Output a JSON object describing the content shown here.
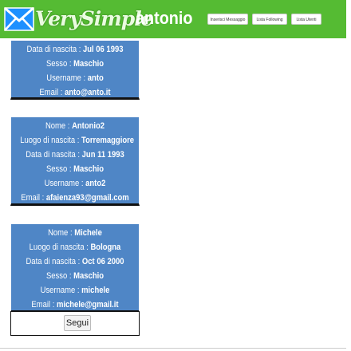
{
  "header": {
    "logo_text": "VerySimple",
    "username": "antonio",
    "nav": [
      {
        "label": "Inserisci Messaggio"
      },
      {
        "label": "Lista Following"
      },
      {
        "label": "Lista Utenti"
      }
    ],
    "colors": {
      "bar": "#55bb33",
      "card": "#4f86c6"
    }
  },
  "users": [
    {
      "lines": [
        {
          "label": "Data di nascita : ",
          "value": "Jul 06 1993"
        },
        {
          "label": "Sesso : ",
          "value": "Maschio"
        },
        {
          "label": "Username : ",
          "value": "anto"
        },
        {
          "label": "Email : ",
          "value": "anto@anto.it"
        }
      ]
    },
    {
      "lines": [
        {
          "label": "Nome : ",
          "value": "Antonio2"
        },
        {
          "label": "Luogo di nascita : ",
          "value": "Torremaggiore"
        },
        {
          "label": "Data di nascita : ",
          "value": "Jun 11 1993"
        },
        {
          "label": "Sesso : ",
          "value": "Maschio"
        },
        {
          "label": "Username : ",
          "value": "anto2"
        },
        {
          "label": "Email : ",
          "value": "afaienza93@gmail.com"
        }
      ]
    },
    {
      "lines": [
        {
          "label": "Nome : ",
          "value": "Michele"
        },
        {
          "label": "Luogo di nascita : ",
          "value": "Bologna"
        },
        {
          "label": "Data di nascita : ",
          "value": "Oct 06 2000"
        },
        {
          "label": "Sesso : ",
          "value": "Maschio"
        },
        {
          "label": "Username : ",
          "value": "michele"
        },
        {
          "label": "Email : ",
          "value": "michele@gmail.it"
        }
      ]
    }
  ],
  "pagination": {
    "next_label": "Segui"
  }
}
